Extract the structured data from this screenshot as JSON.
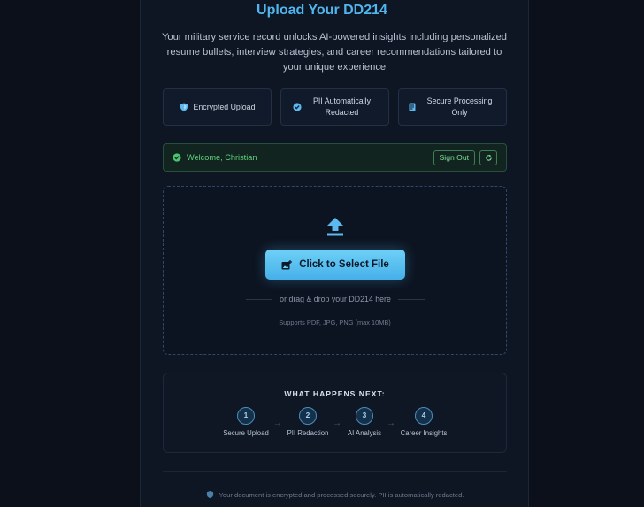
{
  "header": {
    "title": "Upload Your DD214",
    "subtitle": "Your military service record unlocks AI-powered insights including personalized resume bullets, interview strategies, and career recommendations tailored to your unique experience"
  },
  "features": [
    {
      "label": "Encrypted Upload",
      "icon": "shield-icon"
    },
    {
      "label": "PII Automatically Redacted",
      "icon": "check-circle-icon"
    },
    {
      "label": "Secure Processing Only",
      "icon": "document-icon"
    }
  ],
  "welcome": {
    "text": "Welcome, Christian",
    "sign_out_label": "Sign Out",
    "icon": "check-circle-icon"
  },
  "upload": {
    "button_label": "Click to Select File",
    "drag_text": "or drag & drop your DD214 here",
    "supports_text": "Supports PDF, JPG, PNG (max 10MB)"
  },
  "next": {
    "title": "WHAT HAPPENS NEXT:",
    "steps": [
      {
        "num": "1",
        "label": "Secure Upload"
      },
      {
        "num": "2",
        "label": "PII Redaction"
      },
      {
        "num": "3",
        "label": "AI Analysis"
      },
      {
        "num": "4",
        "label": "Career Insights"
      }
    ]
  },
  "footer": {
    "text": "Your document is encrypted and processed securely. PII is automatically redacted."
  },
  "colors": {
    "background": "#0b101b",
    "accent": "#4fb6ee",
    "success": "#5fd07f"
  }
}
